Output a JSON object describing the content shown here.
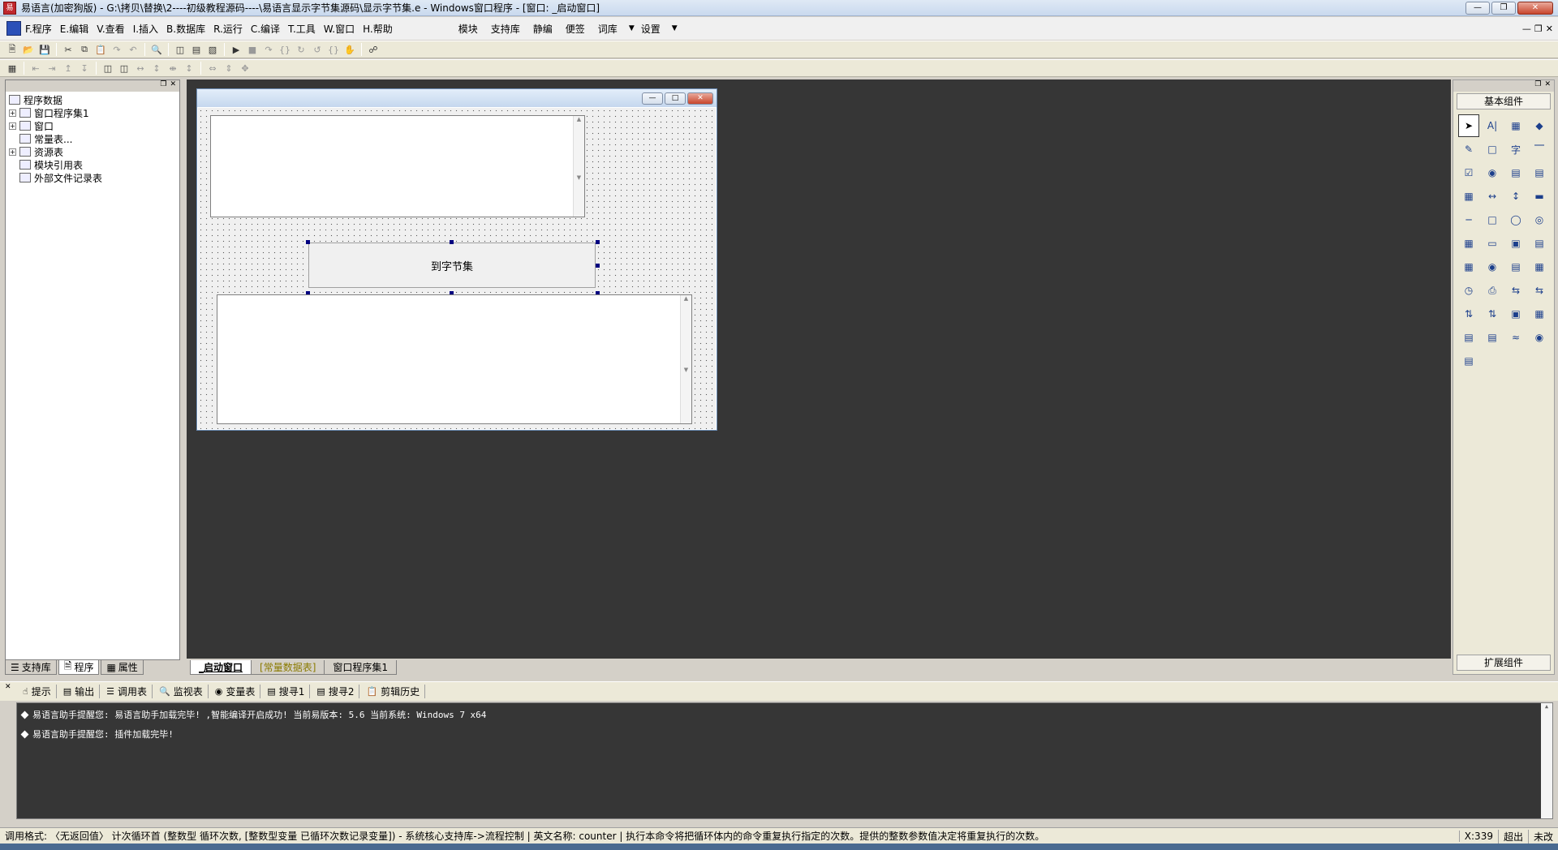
{
  "window": {
    "title": "易语言(加密狗版) - G:\\拷贝\\替换\\2----初级教程源码----\\易语言显示字节集源码\\显示字节集.e - Windows窗口程序 - [窗口: _启动窗口]",
    "app_icon_text": "易"
  },
  "menubar": {
    "items": [
      "F.程序",
      "E.编辑",
      "V.查看",
      "I.插入",
      "B.数据库",
      "R.运行",
      "C.编译",
      "T.工具",
      "W.窗口",
      "H.帮助"
    ],
    "right_items": [
      "模块",
      "支持库",
      "静编",
      "便签",
      "词库",
      "设置"
    ]
  },
  "sidebar": {
    "tree": [
      {
        "label": "程序数据",
        "level": 0,
        "expand": false
      },
      {
        "label": "窗口程序集1",
        "level": 1,
        "expand": true
      },
      {
        "label": "窗口",
        "level": 1,
        "expand": true
      },
      {
        "label": "常量表...",
        "level": 1,
        "expand": false
      },
      {
        "label": "资源表",
        "level": 1,
        "expand": true
      },
      {
        "label": "模块引用表",
        "level": 1,
        "expand": false
      },
      {
        "label": "外部文件记录表",
        "level": 1,
        "expand": false
      }
    ],
    "tabs": [
      "支持库",
      "程序",
      "属性"
    ]
  },
  "designer": {
    "button_label": "到字节集"
  },
  "doc_tabs": [
    "_启动窗口",
    "[常量数据表]",
    "窗口程序集1"
  ],
  "palette": {
    "title": "基本组件",
    "bottom": "扩展组件"
  },
  "output": {
    "tabs": [
      "提示",
      "输出",
      "调用表",
      "监视表",
      "变量表",
      "搜寻1",
      "搜寻2",
      "剪辑历史"
    ],
    "lines": [
      "易语言助手提醒您: 易语言助手加载完毕! ,智能编译开启成功! 当前易版本: 5.6 当前系统: Windows 7 x64",
      "易语言助手提醒您: 插件加载完毕!"
    ]
  },
  "statusbar": {
    "text": "调用格式: 〈无返回值〉 计次循环首 (整数型 循环次数, [整数型变量 已循环次数记录变量]) - 系统核心支持库->流程控制   |   英文名称: counter   |   执行本命令将把循环体内的命令重复执行指定的次数。提供的整数参数值决定将重复执行的次数。",
    "coord": "X:339",
    "mode1": "超出",
    "mode2": "未改"
  }
}
